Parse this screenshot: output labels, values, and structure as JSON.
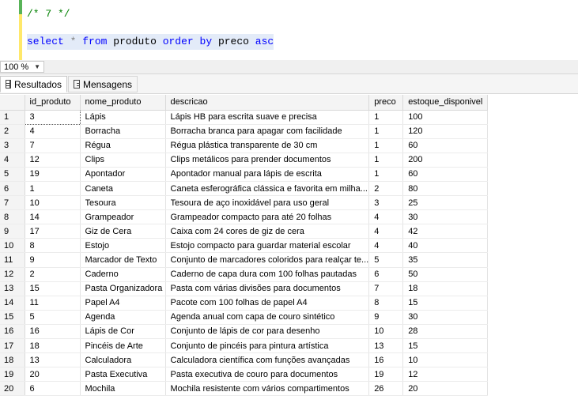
{
  "editor": {
    "comment": "/* 7 */",
    "query": {
      "select": "select",
      "star": "*",
      "from": "from",
      "table": "produto",
      "order": "order",
      "by": "by",
      "column": "preco",
      "asc": "asc"
    }
  },
  "zoom": {
    "value": "100 %"
  },
  "tabs": {
    "results": "Resultados",
    "messages": "Mensagens"
  },
  "grid": {
    "columns": [
      "id_produto",
      "nome_produto",
      "descricao",
      "preco",
      "estoque_disponivel"
    ],
    "rows": [
      [
        "1",
        "3",
        "Lápis",
        "Lápis HB para escrita suave e precisa",
        "1",
        "100"
      ],
      [
        "2",
        "4",
        "Borracha",
        "Borracha branca para apagar com facilidade",
        "1",
        "120"
      ],
      [
        "3",
        "7",
        "Régua",
        "Régua plástica transparente de 30 cm",
        "1",
        "60"
      ],
      [
        "4",
        "12",
        "Clips",
        "Clips metálicos para prender documentos",
        "1",
        "200"
      ],
      [
        "5",
        "19",
        "Apontador",
        "Apontador manual para lápis de escrita",
        "1",
        "60"
      ],
      [
        "6",
        "1",
        "Caneta",
        "Caneta esferográfica clássica e favorita em milha...",
        "2",
        "80"
      ],
      [
        "7",
        "10",
        "Tesoura",
        "Tesoura de aço inoxidável para uso geral",
        "3",
        "25"
      ],
      [
        "8",
        "14",
        "Grampeador",
        "Grampeador compacto para até 20 folhas",
        "4",
        "30"
      ],
      [
        "9",
        "17",
        "Giz de Cera",
        "Caixa com 24 cores de giz de cera",
        "4",
        "42"
      ],
      [
        "10",
        "8",
        "Estojo",
        "Estojo compacto para guardar material escolar",
        "4",
        "40"
      ],
      [
        "11",
        "9",
        "Marcador de Texto",
        "Conjunto de marcadores coloridos para realçar te...",
        "5",
        "35"
      ],
      [
        "12",
        "2",
        "Caderno",
        "Caderno de capa dura com 100 folhas pautadas",
        "6",
        "50"
      ],
      [
        "13",
        "15",
        "Pasta Organizadora",
        "Pasta com várias divisões para documentos",
        "7",
        "18"
      ],
      [
        "14",
        "11",
        "Papel A4",
        "Pacote com 100 folhas de papel A4",
        "8",
        "15"
      ],
      [
        "15",
        "5",
        "Agenda",
        "Agenda anual com capa de couro sintético",
        "9",
        "30"
      ],
      [
        "16",
        "16",
        "Lápis de Cor",
        "Conjunto de lápis de cor para desenho",
        "10",
        "28"
      ],
      [
        "17",
        "18",
        "Pincéis de Arte",
        "Conjunto de pincéis para pintura artística",
        "13",
        "15"
      ],
      [
        "18",
        "13",
        "Calculadora",
        "Calculadora científica com funções avançadas",
        "16",
        "10"
      ],
      [
        "19",
        "20",
        "Pasta Executiva",
        "Pasta executiva de couro para documentos",
        "19",
        "12"
      ],
      [
        "20",
        "6",
        "Mochila",
        "Mochila resistente com vários compartimentos",
        "26",
        "20"
      ]
    ]
  }
}
